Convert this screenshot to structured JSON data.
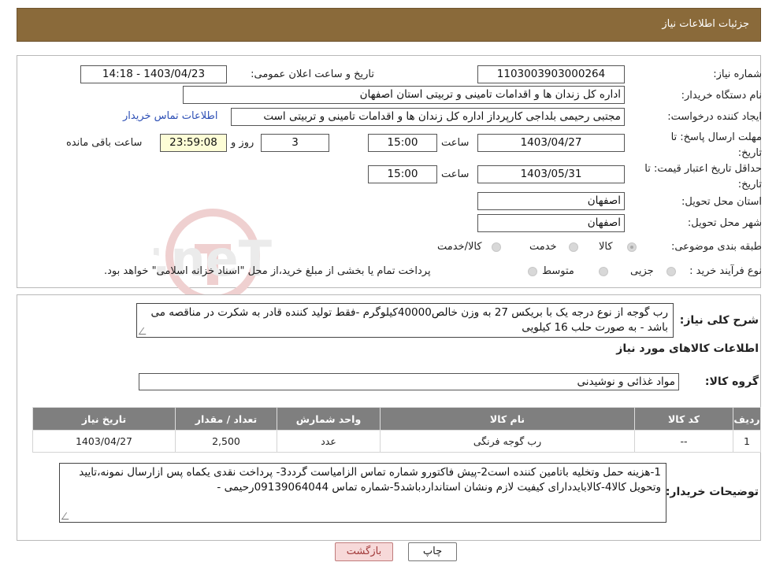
{
  "header": {
    "title": "جزئیات اطلاعات نیاز"
  },
  "watermark": {
    "text": "AriaTender.neT"
  },
  "fields": {
    "need_number_label": "شماره نیاز:",
    "need_number": "1103003903000264",
    "announce_label": "تاریخ و ساعت اعلان عمومی:",
    "announce_value": "1403/04/23 - 14:18",
    "buyer_org_label": "نام دستگاه خریدار:",
    "buyer_org": "اداره کل زندان ها و اقدامات تامینی و تربیتی استان اصفهان",
    "creator_label": "ایجاد کننده درخواست:",
    "creator": "مجتبی رحیمی بلداجی کارپرداز اداره کل زندان ها و اقدامات تامینی و تربیتی است",
    "contact_link": "اطلاعات تماس خریدار",
    "deadline_label": "مهلت ارسال پاسخ: تا تاریخ:",
    "deadline_date": "1403/04/27",
    "time_label": "ساعت",
    "deadline_time": "15:00",
    "days_value": "3",
    "days_label": "روز و",
    "remaining_time": "23:59:08",
    "remaining_label": "ساعت باقی مانده",
    "validity_label": "حداقل تاریخ اعتبار قیمت: تا تاریخ:",
    "validity_date": "1403/05/31",
    "validity_time": "15:00",
    "province_label": "استان محل تحویل:",
    "province": "اصفهان",
    "city_label": "شهر محل تحویل:",
    "city": "اصفهان",
    "category_label": "طبقه بندی موضوعی:",
    "category_options": [
      "کالا",
      "خدمت",
      "کالا/خدمت"
    ],
    "process_label": "نوع فرآیند خرید :",
    "process_options": [
      "جزیی",
      "متوسط"
    ],
    "process_note": "پرداخت تمام یا بخشی از مبلغ خرید،از محل \"اسناد خزانه اسلامی\" خواهد بود."
  },
  "summary": {
    "label": "شرح کلی نیاز:",
    "text": "رب گوجه از نوع درجه یک با بریکس 27 به وزن خالص40000کیلوگرم -فقط تولید کننده قادر به شکرت در مناقصه می باشد  - به صورت حلب 16 کیلویی"
  },
  "goods": {
    "section_title": "اطلاعات کالاهای مورد نیاز",
    "group_label": "گروه کالا:",
    "group_value": "مواد غذائی و نوشیدنی",
    "columns": [
      "ردیف",
      "کد کالا",
      "نام کالا",
      "واحد شمارش",
      "تعداد / مقدار",
      "تاریخ نیاز"
    ],
    "rows": [
      [
        "1",
        "--",
        "رب گوجه فرنگی",
        "عدد",
        "2,500",
        "1403/04/27"
      ]
    ]
  },
  "notes": {
    "label": "توضیحات خریدار:",
    "text": "1-هزینه حمل وتخلیه باتامین کننده است2-پیش فاکتورو شماره تماس الزامیاست گردد3- پرداخت نقدی یکماه  پس ازارسال نمونه،تایید وتحویل کالا4-کالابایددارای کیفیت لازم ونشان استانداردباشد5-شماره تماس 09139064044رحیمی -"
  },
  "buttons": {
    "print": "چاپ",
    "back": "بازگشت"
  },
  "colors": {
    "header": "#8a6a3a",
    "table_header": "#7f7f7f",
    "link": "#2d4fb5"
  }
}
